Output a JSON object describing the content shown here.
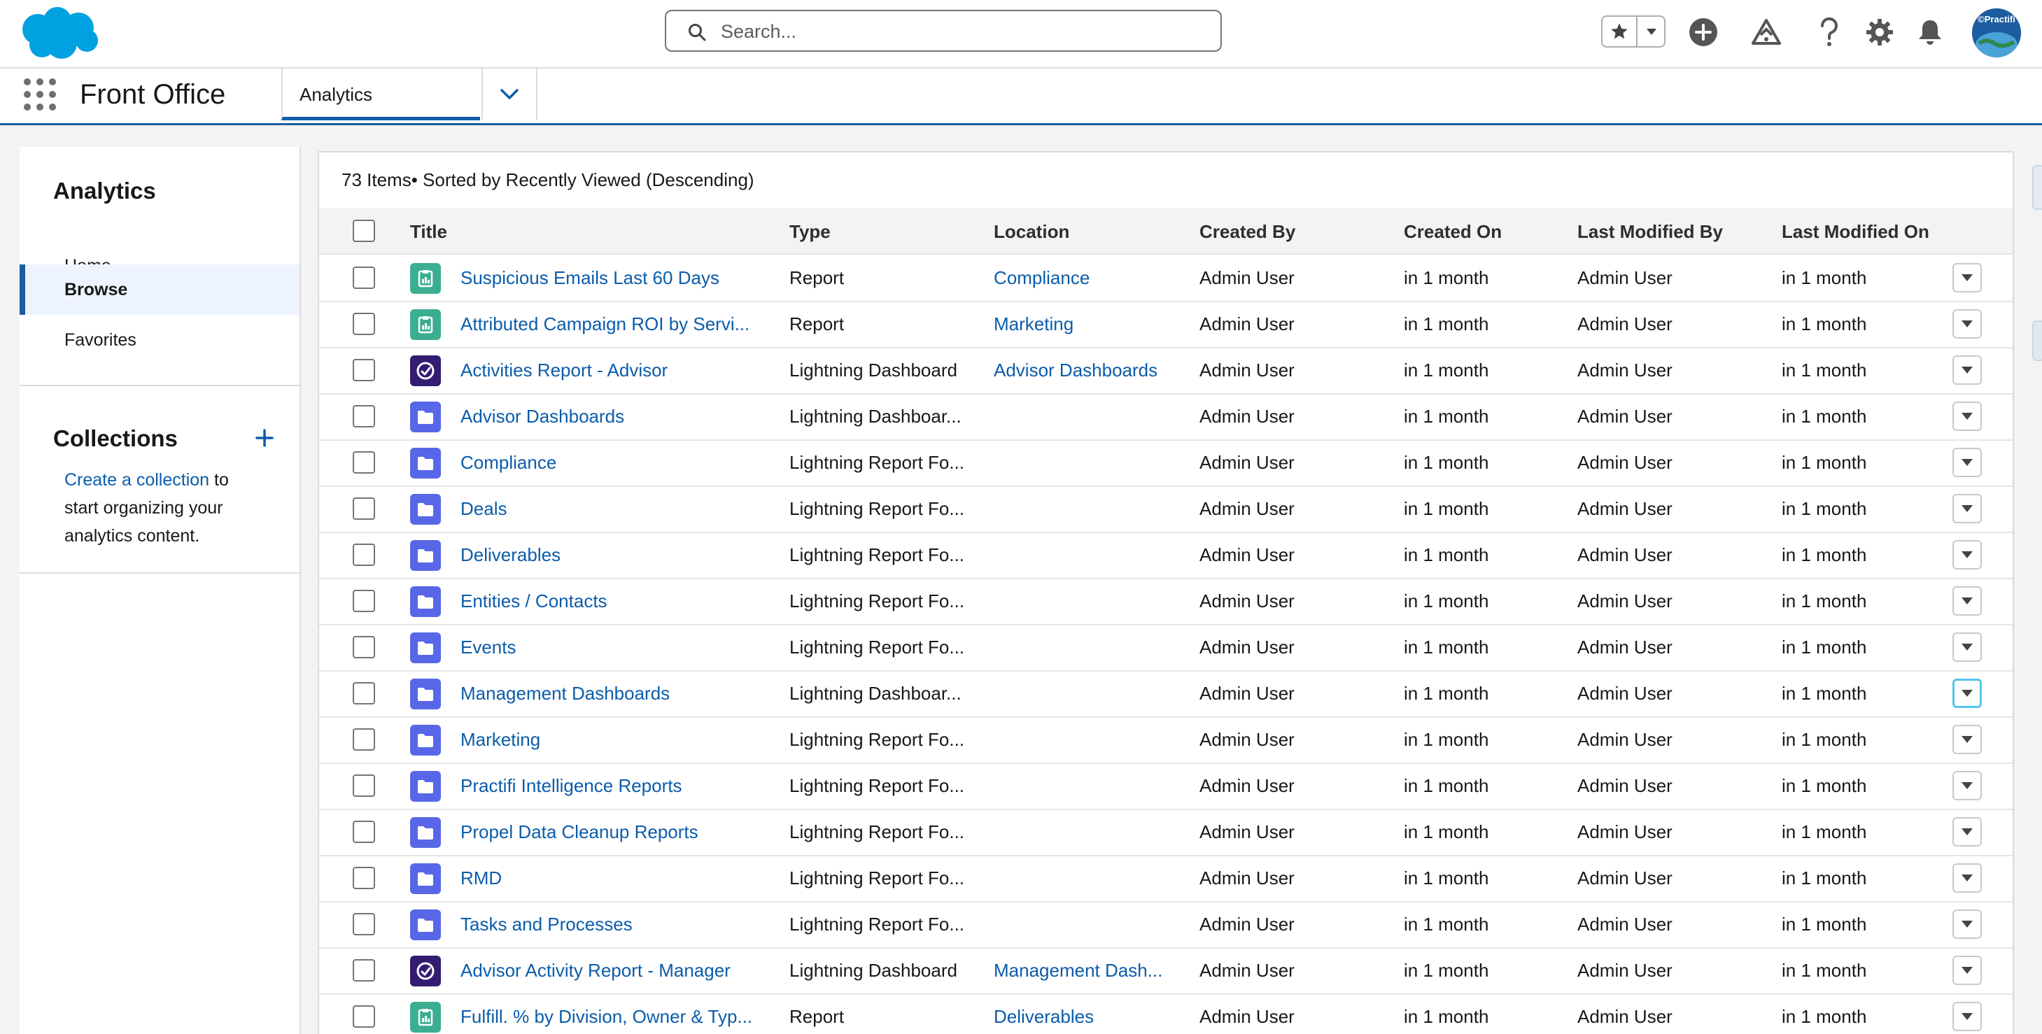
{
  "header": {
    "search_placeholder": "Search...",
    "avatar_label": "©Practifi",
    "icons": [
      "salesforce-cloud-logo",
      "search-icon",
      "star-icon",
      "caret-down-icon",
      "add-icon",
      "trailhead-icon",
      "help-icon",
      "gear-icon",
      "bell-icon"
    ]
  },
  "nav": {
    "app_name": "Front Office",
    "tab_label": "Analytics",
    "accent": "#0b5cab"
  },
  "sidebar": {
    "title": "Analytics",
    "items": [
      {
        "label": "Home"
      },
      {
        "label": "Browse"
      },
      {
        "label": "Favorites"
      }
    ],
    "collections_title": "Collections",
    "collections_link": "Create a collection",
    "collections_text_1": " to",
    "collections_text_2": "start organizing your",
    "collections_text_3": "analytics content."
  },
  "list": {
    "summary": "73 Items• Sorted by Recently Viewed (Descending)",
    "columns": [
      "Title",
      "Type",
      "Location",
      "Created By",
      "Created On",
      "Last Modified By",
      "Last Modified On"
    ],
    "rows": [
      {
        "icon": "report",
        "title": "Suspicious Emails Last 60 Days",
        "type": "Report",
        "location": "Compliance",
        "created_by": "Admin User",
        "created_on": "in 1 month",
        "modified_by": "Admin User",
        "modified_on": "in 1 month"
      },
      {
        "icon": "report",
        "title": "Attributed Campaign ROI by Servi...",
        "type": "Report",
        "location": "Marketing",
        "created_by": "Admin User",
        "created_on": "in 1 month",
        "modified_by": "Admin User",
        "modified_on": "in 1 month"
      },
      {
        "icon": "dashboard",
        "title": "Activities Report - Advisor",
        "type": "Lightning Dashboard",
        "location": "Advisor Dashboards",
        "created_by": "Admin User",
        "created_on": "in 1 month",
        "modified_by": "Admin User",
        "modified_on": "in 1 month"
      },
      {
        "icon": "folder",
        "title": "Advisor Dashboards",
        "type": "Lightning Dashboar...",
        "location": "",
        "created_by": "Admin User",
        "created_on": "in 1 month",
        "modified_by": "Admin User",
        "modified_on": "in 1 month"
      },
      {
        "icon": "folder",
        "title": "Compliance",
        "type": "Lightning Report Fo...",
        "location": "",
        "created_by": "Admin User",
        "created_on": "in 1 month",
        "modified_by": "Admin User",
        "modified_on": "in 1 month"
      },
      {
        "icon": "folder",
        "title": "Deals",
        "type": "Lightning Report Fo...",
        "location": "",
        "created_by": "Admin User",
        "created_on": "in 1 month",
        "modified_by": "Admin User",
        "modified_on": "in 1 month"
      },
      {
        "icon": "folder",
        "title": "Deliverables",
        "type": "Lightning Report Fo...",
        "location": "",
        "created_by": "Admin User",
        "created_on": "in 1 month",
        "modified_by": "Admin User",
        "modified_on": "in 1 month"
      },
      {
        "icon": "folder",
        "title": "Entities / Contacts",
        "type": "Lightning Report Fo...",
        "location": "",
        "created_by": "Admin User",
        "created_on": "in 1 month",
        "modified_by": "Admin User",
        "modified_on": "in 1 month"
      },
      {
        "icon": "folder",
        "title": "Events",
        "type": "Lightning Report Fo...",
        "location": "",
        "created_by": "Admin User",
        "created_on": "in 1 month",
        "modified_by": "Admin User",
        "modified_on": "in 1 month"
      },
      {
        "icon": "folder",
        "title": "Management Dashboards",
        "type": "Lightning Dashboar...",
        "location": "",
        "created_by": "Admin User",
        "created_on": "in 1 month",
        "modified_by": "Admin User",
        "modified_on": "in 1 month",
        "focused": true
      },
      {
        "icon": "folder",
        "title": "Marketing",
        "type": "Lightning Report Fo...",
        "location": "",
        "created_by": "Admin User",
        "created_on": "in 1 month",
        "modified_by": "Admin User",
        "modified_on": "in 1 month"
      },
      {
        "icon": "folder",
        "title": "Practifi Intelligence Reports",
        "type": "Lightning Report Fo...",
        "location": "",
        "created_by": "Admin User",
        "created_on": "in 1 month",
        "modified_by": "Admin User",
        "modified_on": "in 1 month"
      },
      {
        "icon": "folder",
        "title": "Propel Data Cleanup Reports",
        "type": "Lightning Report Fo...",
        "location": "",
        "created_by": "Admin User",
        "created_on": "in 1 month",
        "modified_by": "Admin User",
        "modified_on": "in 1 month"
      },
      {
        "icon": "folder",
        "title": "RMD",
        "type": "Lightning Report Fo...",
        "location": "",
        "created_by": "Admin User",
        "created_on": "in 1 month",
        "modified_by": "Admin User",
        "modified_on": "in 1 month"
      },
      {
        "icon": "folder",
        "title": "Tasks and Processes",
        "type": "Lightning Report Fo...",
        "location": "",
        "created_by": "Admin User",
        "created_on": "in 1 month",
        "modified_by": "Admin User",
        "modified_on": "in 1 month"
      },
      {
        "icon": "dashboard",
        "title": "Advisor Activity Report - Manager",
        "type": "Lightning Dashboard",
        "location": "Management Dash...",
        "created_by": "Admin User",
        "created_on": "in 1 month",
        "modified_by": "Admin User",
        "modified_on": "in 1 month"
      },
      {
        "icon": "report",
        "title": "Fulfill. % by Division, Owner & Typ...",
        "type": "Report",
        "location": "Deliverables",
        "created_by": "Admin User",
        "created_on": "in 1 month",
        "modified_by": "Admin User",
        "modified_on": "in 1 month"
      }
    ]
  }
}
